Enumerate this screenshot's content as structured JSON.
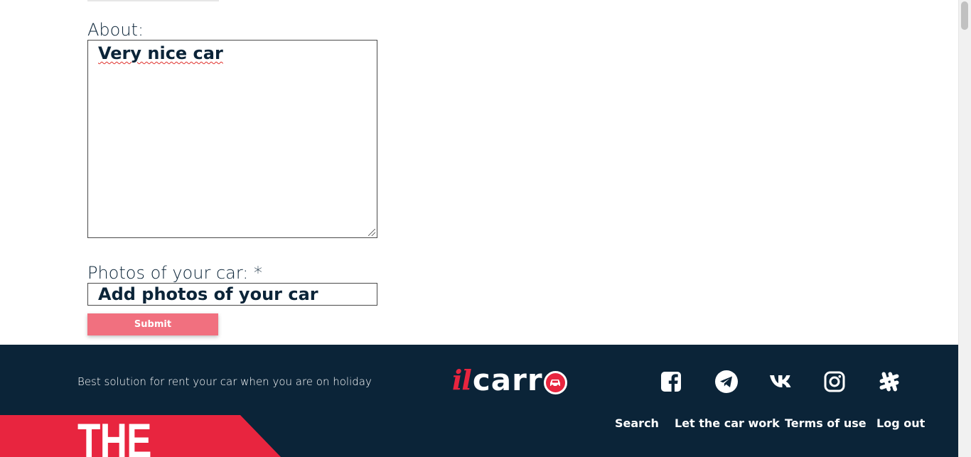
{
  "form": {
    "about_label": "About:",
    "about_value": "Very nice car",
    "photos_label": "Photos of your car: *",
    "photos_placeholder": "Add photos of your car",
    "submit_label": "Submit"
  },
  "footer": {
    "tagline": "Best solution for rent your car when you are on holiday",
    "logo": {
      "prefix": "il",
      "main": "carr"
    },
    "socials": [
      "facebook-icon",
      "telegram-icon",
      "vk-icon",
      "instagram-icon",
      "slack-icon"
    ],
    "nav": {
      "search": "Search",
      "let_the_car_work": "Let the car work",
      "terms_of_use": "Terms of use",
      "log_out": "Log out"
    },
    "banner_text": "THE"
  },
  "colors": {
    "footer_bg": "#0b2438",
    "accent_red": "#e8253f",
    "submit_bg": "#f1707f",
    "text_dark": "#0b2438"
  }
}
